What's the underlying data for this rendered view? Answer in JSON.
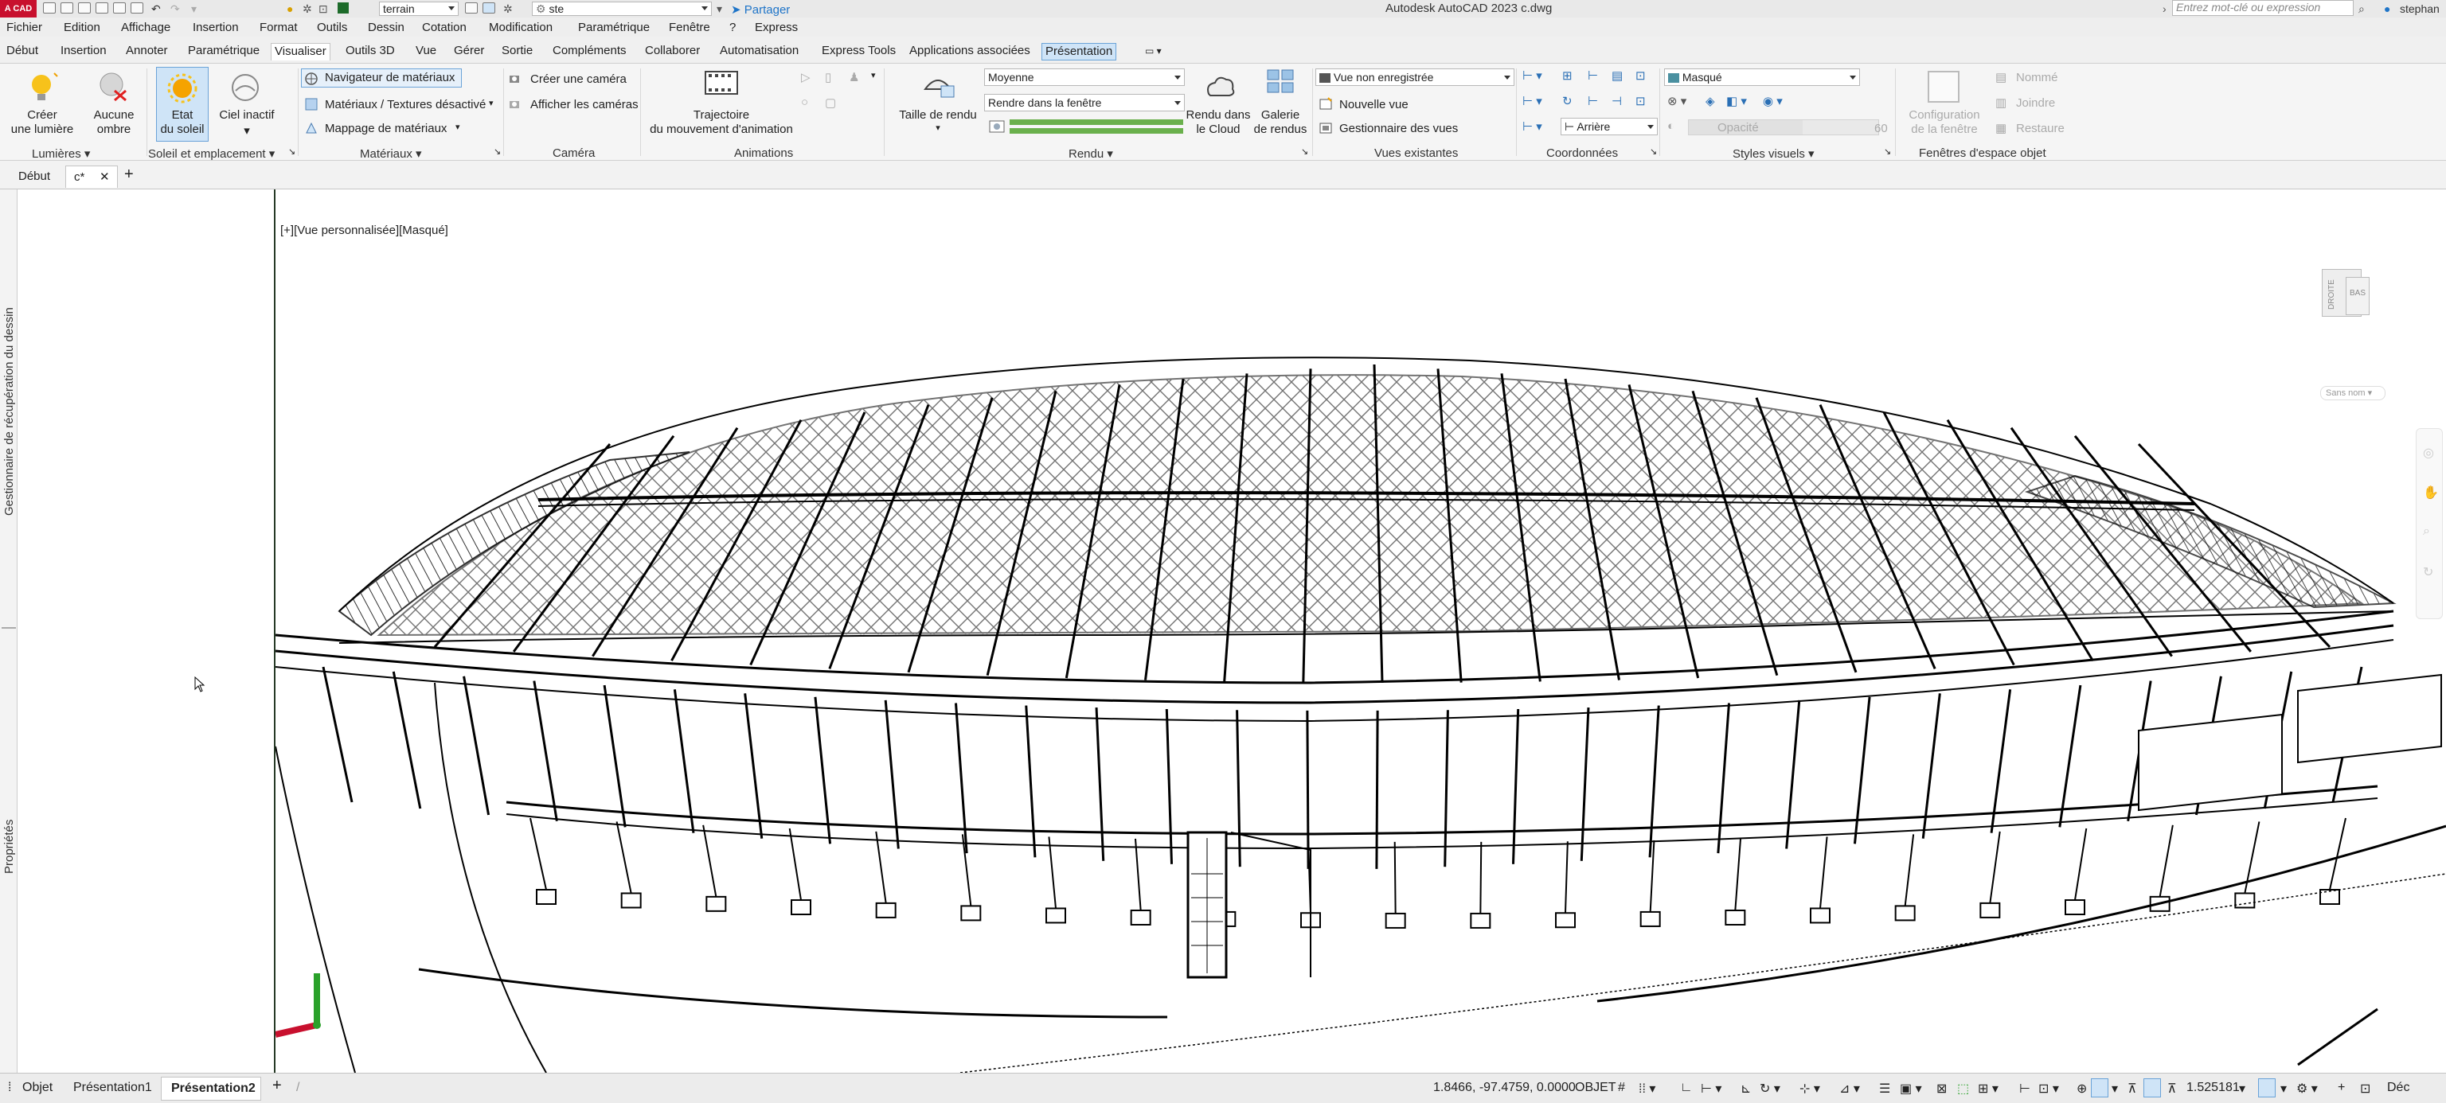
{
  "titlebar": {
    "logo": "A CAD",
    "layer_combo": "terrain",
    "style_combo": "ste",
    "share": "Partager",
    "title": "Autodesk AutoCAD 2023   c.dwg",
    "search_placeholder": "Entrez mot-clé ou expression",
    "user": "stephan"
  },
  "menu": [
    "Fichier",
    "Edition",
    "Affichage",
    "Insertion",
    "Format",
    "Outils",
    "Dessin",
    "Cotation",
    "Modification",
    "Paramétrique",
    "Fenêtre",
    "?",
    "Express"
  ],
  "ribbon_tabs": [
    "Début",
    "Insertion",
    "Annoter",
    "Paramétrique",
    "Visualiser",
    "Outils 3D",
    "Vue",
    "Gérer",
    "Sortie",
    "Compléments",
    "Collaborer",
    "Automatisation",
    "Express Tools",
    "Applications associées",
    "Présentation"
  ],
  "ribbon": {
    "lights": {
      "create_light": "Créer\nune lumière",
      "no_shadow": "Aucune\nombre",
      "title": "Lumières"
    },
    "sun": {
      "sun_status": "Etat\ndu soleil",
      "sky_off": "Ciel inactif",
      "title": "Soleil et emplacement"
    },
    "materials": {
      "browser": "Navigateur de matériaux",
      "textures": "Matériaux / Textures désactivé",
      "mapping": "Mappage de matériaux",
      "title": "Matériaux"
    },
    "camera": {
      "create": "Créer une caméra",
      "show": "Afficher les caméras",
      "title": "Caméra"
    },
    "animations": {
      "path": "Trajectoire\ndu mouvement d'animation",
      "title": "Animations"
    },
    "render": {
      "size": "Taille de rendu",
      "quality": "Moyenne",
      "render_in": "Rendre dans la fenêtre",
      "cloud": "Rendu dans\nle Cloud",
      "gallery": "Galerie\nde rendus",
      "title": "Rendu"
    },
    "views": {
      "unsaved": "Vue non enregistrée",
      "new_view": "Nouvelle vue",
      "manager": "Gestionnaire des vues",
      "title": "Vues existantes"
    },
    "coords": {
      "back": "Arrière",
      "title": "Coordonnées"
    },
    "visual_styles": {
      "style": "Masqué",
      "opacity_label": "Opacité",
      "opacity_value": "60",
      "title": "Styles visuels"
    },
    "viewports": {
      "config": "Configuration\nde la fenêtre",
      "named": "Nommé",
      "join": "Joindre",
      "restore": "Restaure",
      "title": "Fenêtres d'espace objet"
    }
  },
  "file_tabs": {
    "start": "Début",
    "current": "c*"
  },
  "palettes": {
    "recovery": "Gestionnaire de récupération du dessin",
    "properties": "Propriétés"
  },
  "viewport": {
    "label": "[+][Vue personnalisée][Masqué]",
    "viewcube_right": "DROITE",
    "viewcube_bottom": "BAS",
    "ucs_name": "Sans nom"
  },
  "layout_tabs": [
    "Objet",
    "Présentation1",
    "Présentation2"
  ],
  "status": {
    "coords": "1.8466, -97.4759, 0.0000",
    "mode": "OBJET",
    "scale": "1.525181",
    "dec": "Déc"
  }
}
